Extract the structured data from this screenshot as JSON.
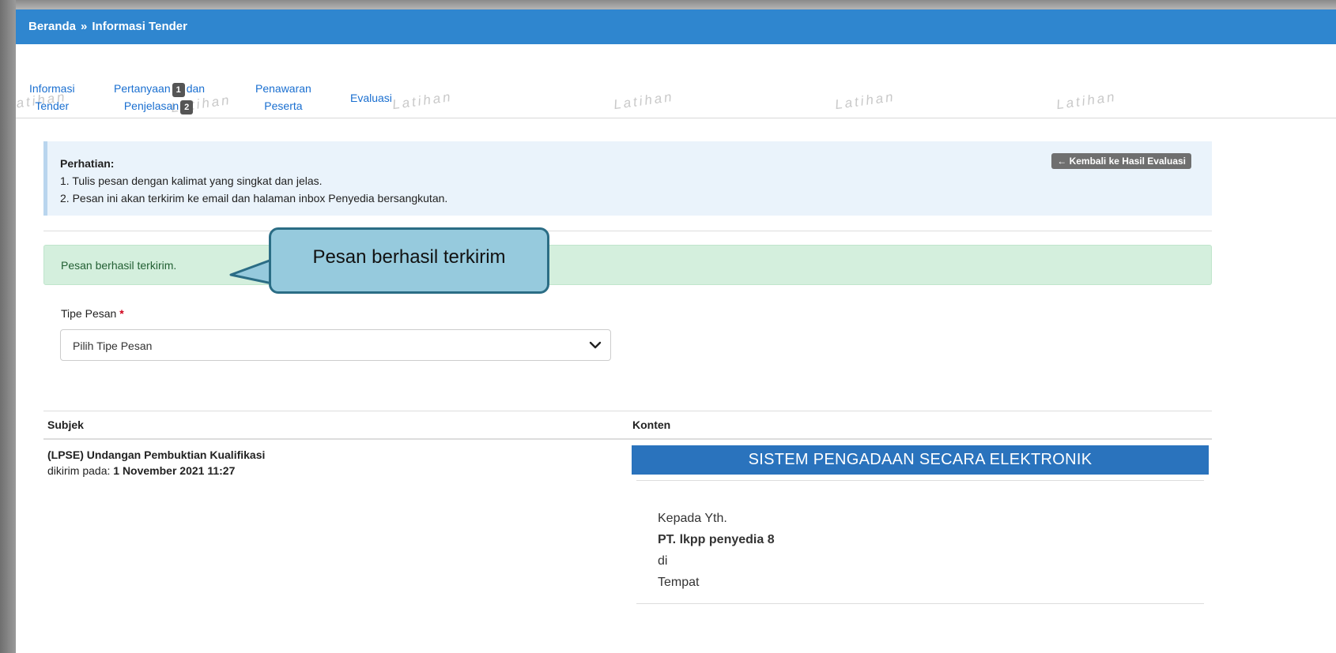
{
  "breadcrumb": {
    "home": "Beranda",
    "separator": "»",
    "current": "Informasi Tender"
  },
  "tabs": [
    {
      "line1": "Informasi",
      "line2": "Tender"
    },
    {
      "line1": "Pertanyaan",
      "badge1": "1",
      "line1_after": "dan",
      "line2": "Penjelasan",
      "badge2": "2"
    },
    {
      "line1": "Penawaran",
      "line2": "Peserta"
    },
    {
      "line1": "Evaluasi"
    }
  ],
  "watermark_text": "Latihan",
  "notice": {
    "title": "Perhatian:",
    "items": [
      "1. Tulis pesan dengan kalimat yang singkat dan jelas.",
      "2. Pesan ini akan terkirim ke email dan halaman inbox Penyedia bersangkutan."
    ],
    "back_button": "← Kembali ke Hasil Evaluasi"
  },
  "alert": {
    "message": "Pesan berhasil terkirim."
  },
  "callout": {
    "text": "Pesan berhasil terkirim"
  },
  "form": {
    "tipe_label": "Tipe Pesan",
    "required_mark": "*",
    "tipe_selected": "Pilih Tipe Pesan"
  },
  "table": {
    "col_subject": "Subjek",
    "col_content": "Konten",
    "row": {
      "subject": "(LPSE) Undangan Pembuktian Kualifikasi",
      "sent_prefix": "dikirim pada:",
      "sent_date": "1 November 2021 11:27",
      "email": {
        "banner": "SISTEM PENGADAAN SECARA ELEKTRONIK",
        "greeting": "Kepada Yth.",
        "recipient": "PT. lkpp penyedia 8",
        "di": "di",
        "place": "Tempat"
      }
    }
  },
  "colors": {
    "header": "#2f86cf",
    "link": "#1a6fd0",
    "success_bg": "#d4efdd",
    "callout_bg": "#96cadd",
    "email_banner": "#2a73bd"
  }
}
